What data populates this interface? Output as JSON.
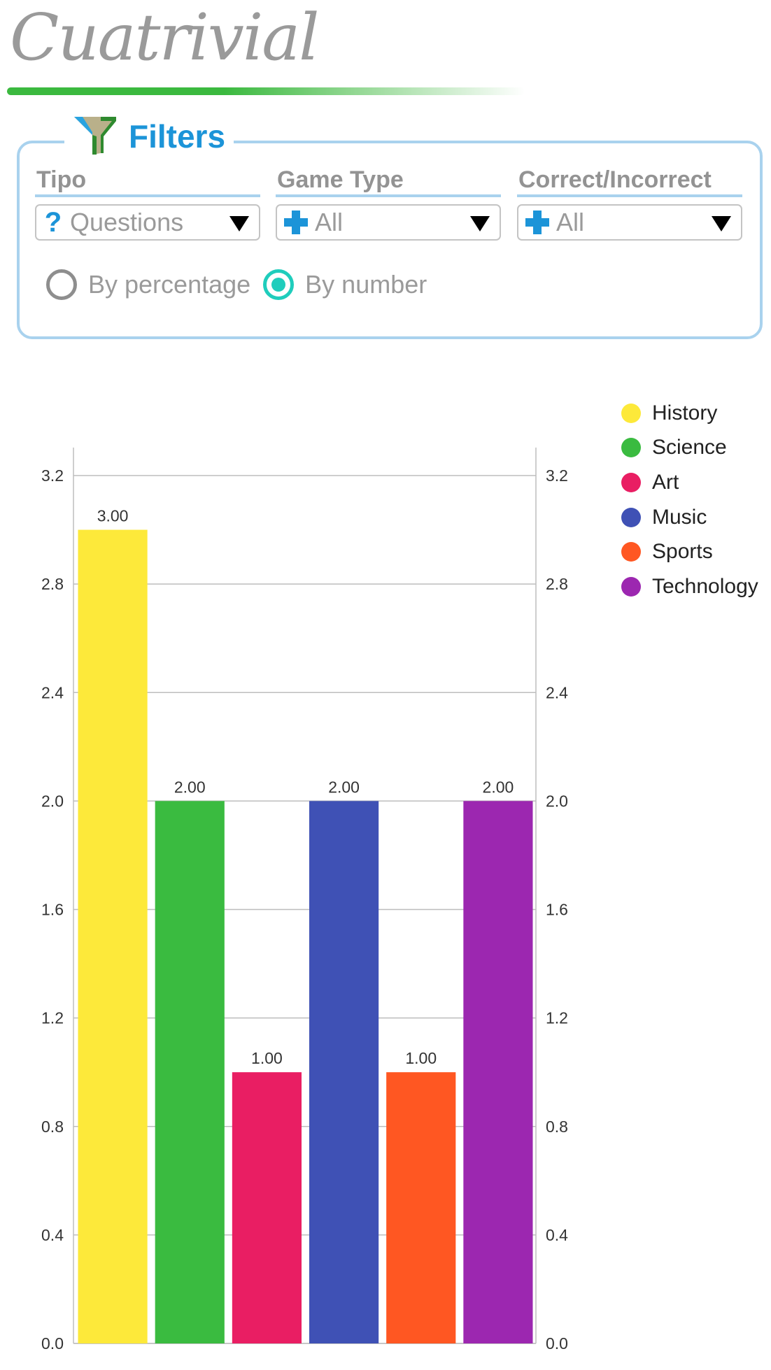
{
  "app": {
    "title": "Cuatrivial"
  },
  "filters": {
    "title": "Filters",
    "icon": "funnel-icon",
    "columns": [
      {
        "label": "Tipo",
        "value": "Questions",
        "icon": "question-icon"
      },
      {
        "label": "Game Type",
        "value": "All",
        "icon": "plus-icon"
      },
      {
        "label": "Correct/Incorrect",
        "value": "All",
        "icon": "plus-icon"
      }
    ],
    "mode_options": [
      {
        "label": "By percentage",
        "selected": false
      },
      {
        "label": "By number",
        "selected": true
      }
    ]
  },
  "colors": {
    "accent": "#1c94d8",
    "border": "#a9d2ee",
    "radio_selected": "#1fcdbc",
    "brand_green": "#3bb93f"
  },
  "chart_data": {
    "type": "bar",
    "title": "",
    "xlabel": "",
    "ylabel": "",
    "categories": [
      "History",
      "Science",
      "Art",
      "Music",
      "Sports",
      "Technology"
    ],
    "values": [
      3,
      2,
      1,
      2,
      1,
      2
    ],
    "value_labels": [
      "3.00",
      "2.00",
      "1.00",
      "2.00",
      "1.00",
      "2.00"
    ],
    "colors": [
      "#fde93a",
      "#3abb40",
      "#e91e63",
      "#3f51b5",
      "#ff5722",
      "#9c27b0"
    ],
    "ylim": [
      0,
      3.3
    ],
    "yticks": [
      "0.0",
      "0.4",
      "0.8",
      "1.2",
      "1.6",
      "2.0",
      "2.4",
      "2.8",
      "3.2"
    ],
    "ytick_values": [
      0,
      0.4,
      0.8,
      1.2,
      1.6,
      2.0,
      2.4,
      2.8,
      3.2
    ],
    "right_axis": true,
    "grid": true,
    "legend_position": "top-right"
  }
}
